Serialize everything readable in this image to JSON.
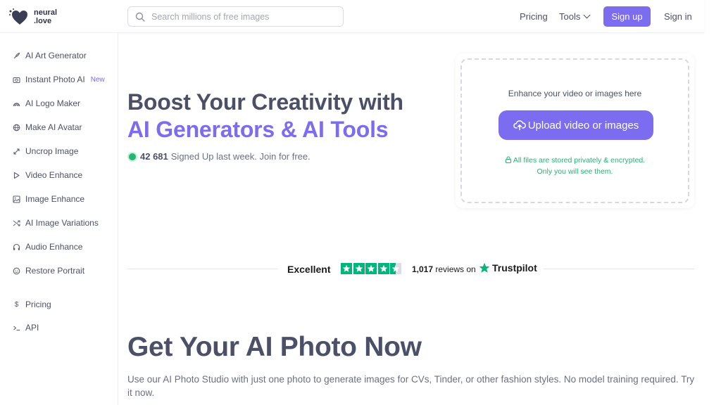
{
  "brand": {
    "line1": "neural",
    "line2": ".love"
  },
  "search": {
    "placeholder": "Search millions of free images"
  },
  "nav": {
    "pricing": "Pricing",
    "tools": "Tools",
    "signup": "Sign up",
    "signin": "Sign in"
  },
  "sidebar": {
    "items": [
      {
        "label": "AI Art Generator",
        "icon": "brush-icon"
      },
      {
        "label": "Instant Photo AI",
        "icon": "camera-icon",
        "badge": "New"
      },
      {
        "label": "AI Logo Maker",
        "icon": "logo-icon"
      },
      {
        "label": "Make AI Avatar",
        "icon": "globe-icon"
      },
      {
        "label": "Uncrop Image",
        "icon": "expand-icon"
      },
      {
        "label": "Video Enhance",
        "icon": "play-icon"
      },
      {
        "label": "Image Enhance",
        "icon": "image-icon"
      },
      {
        "label": "AI Image Variations",
        "icon": "shuffle-icon"
      },
      {
        "label": "Audio Enhance",
        "icon": "headphones-icon"
      },
      {
        "label": "Restore Portrait",
        "icon": "smile-icon"
      },
      {
        "label": "Pricing",
        "icon": "dollar-icon"
      },
      {
        "label": "API",
        "icon": "terminal-icon"
      }
    ]
  },
  "hero": {
    "title_line1": "Boost Your Creativity with",
    "title_line2": "AI Generators & AI Tools",
    "signup_count": "42 681",
    "signup_text": "Signed Up last week. Join for free."
  },
  "upload": {
    "heading": "Enhance your video or images here",
    "button": "Upload video or images",
    "privacy_line1": "All files are stored privately & encrypted.",
    "privacy_line2": "Only you will see them."
  },
  "trustpilot": {
    "rating_word": "Excellent",
    "stars": 4.5,
    "review_count": "1,017",
    "reviews_on": "reviews on",
    "brand": "Trustpilot"
  },
  "section": {
    "title": "Get Your AI Photo Now",
    "description": "Use our AI Photo Studio with just one photo to generate images for CVs, Tinder, or other fashion styles. No model training required. Try it now."
  },
  "colors": {
    "accent": "#7b6cf0",
    "green": "#22b573",
    "trustpilot": "#00b67a",
    "text": "#4b4f68"
  }
}
